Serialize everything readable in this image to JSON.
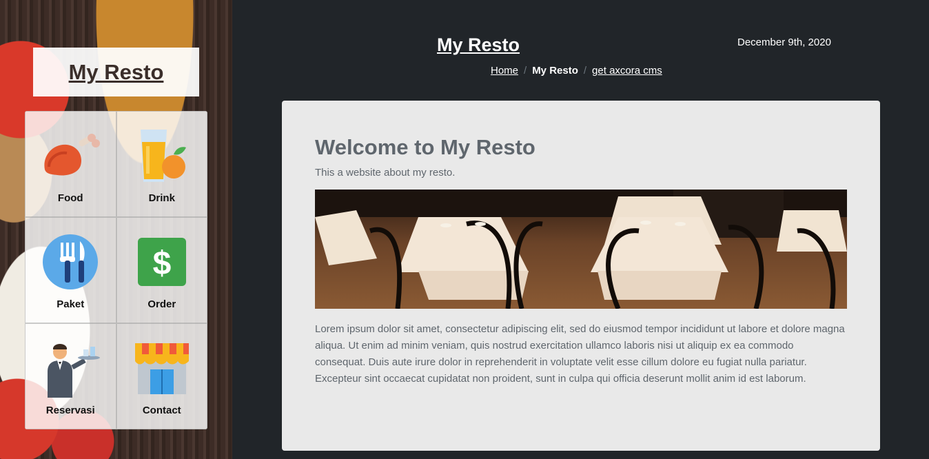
{
  "sidebar": {
    "brand": "My Resto",
    "menu": [
      {
        "label": "Food",
        "icon": "chicken-leg-icon"
      },
      {
        "label": "Drink",
        "icon": "juice-glass-icon"
      },
      {
        "label": "Paket",
        "icon": "fork-knife-icon"
      },
      {
        "label": "Order",
        "icon": "dollar-icon"
      },
      {
        "label": "Reservasi",
        "icon": "waiter-icon"
      },
      {
        "label": "Contact",
        "icon": "storefront-icon"
      }
    ]
  },
  "header": {
    "title": "My Resto",
    "date": "December 9th, 2020",
    "breadcrumb": {
      "home": "Home",
      "current": "My Resto",
      "link": "get axcora cms"
    }
  },
  "main": {
    "heading": "Welcome to My Resto",
    "subtitle": "This a website about my resto.",
    "body": "Lorem ipsum dolor sit amet, consectetur adipiscing elit, sed do eiusmod tempor incididunt ut labore et dolore magna aliqua. Ut enim ad minim veniam, quis nostrud exercitation ullamco laboris nisi ut aliquip ex ea commodo consequat. Duis aute irure dolor in reprehenderit in voluptate velit esse cillum dolore eu fugiat nulla pariatur. Excepteur sint occaecat cupidatat non proident, sunt in culpa qui officia deserunt mollit anim id est laborum."
  },
  "colors": {
    "page_bg": "#212529",
    "card_bg": "#e9e9e9",
    "text_muted": "#5f666d"
  }
}
